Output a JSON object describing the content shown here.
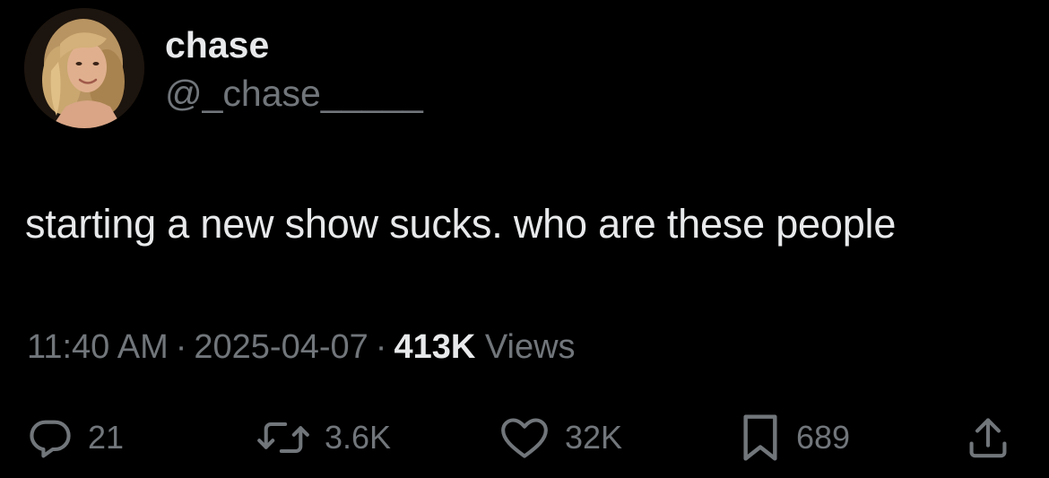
{
  "author": {
    "display_name": "chase",
    "handle": "@_chase_____"
  },
  "tweet": {
    "text": "starting a new show sucks. who are these people"
  },
  "meta": {
    "time": "11:40 AM",
    "separator": "·",
    "date": "2025-04-07",
    "views_count": "413K",
    "views_label": "Views"
  },
  "actions": {
    "replies": "21",
    "retweets": "3.6K",
    "likes": "32K",
    "bookmarks": "689"
  },
  "icons": {
    "reply": "reply-icon",
    "retweet": "retweet-icon",
    "like": "heart-icon",
    "bookmark": "bookmark-icon",
    "share": "share-icon"
  },
  "colors": {
    "background": "#000000",
    "primary_text": "#e7e9ea",
    "secondary_text": "#71767b"
  }
}
